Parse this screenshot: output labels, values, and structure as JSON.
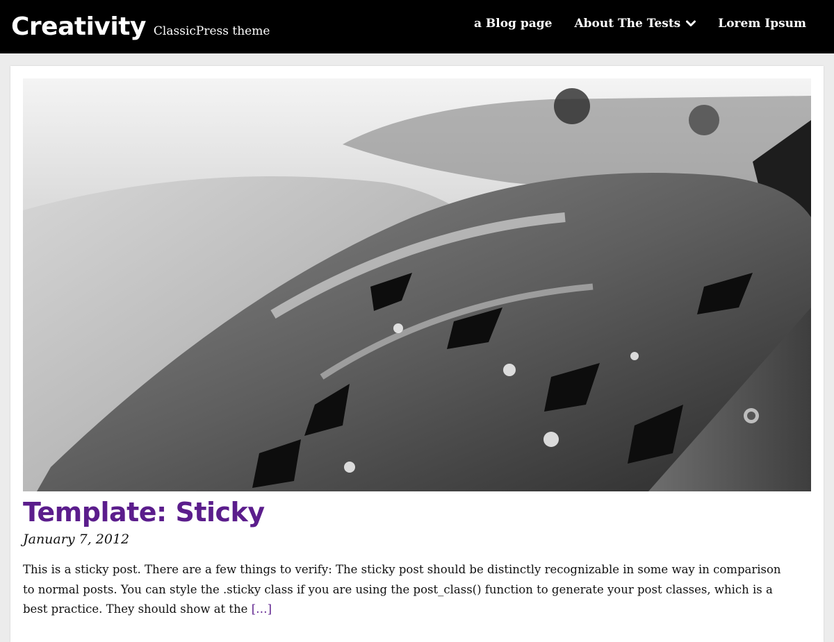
{
  "header": {
    "site_title": "Creativity",
    "tagline": "ClassicPress theme",
    "nav": [
      {
        "label": "a Blog page"
      },
      {
        "label": "About The Tests",
        "has_dropdown": true
      },
      {
        "label": "Lorem Ipsum"
      }
    ]
  },
  "post": {
    "image_icon": "featured-image",
    "title": "Template: Sticky",
    "date": "January 7, 2012",
    "excerpt": "This is a sticky post. There are a few things to verify: The sticky post should be distinctly recognizable in some way in comparison to normal posts. You can style the .sticky class if you are using the post_class() function to generate your post classes, which is a best practice. They should show at the",
    "more_link": "[…]"
  },
  "colors": {
    "header_bg": "#000000",
    "accent": "#5b1d8c",
    "page_bg": "#ececec",
    "card_bg": "#ffffff"
  }
}
